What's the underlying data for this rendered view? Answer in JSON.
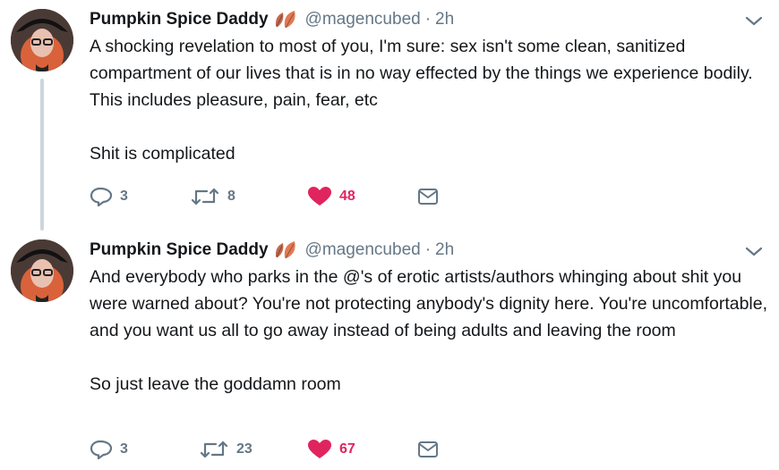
{
  "tweets": [
    {
      "name": "Pumpkin Spice Daddy",
      "emoji": "🍂",
      "handle": "@magencubed",
      "separator": "·",
      "time": "2h",
      "paragraphs": [
        "A shocking revelation to most of you, I'm sure: sex isn't some clean, sanitized compartment of our lives that is in no way effected by the things we experience bodily. This includes pleasure, pain, fear, etc",
        "Shit is complicated"
      ],
      "replies": "3",
      "retweets": "8",
      "likes": "48"
    },
    {
      "name": "Pumpkin Spice Daddy",
      "emoji": "🍂",
      "handle": "@magencubed",
      "separator": "·",
      "time": "2h",
      "paragraphs": [
        "And everybody who parks in the @'s of erotic artists/authors whinging about shit you were warned about? You're not protecting anybody's dignity here. You're uncomfortable, and you want us all to go away instead of being adults and leaving the room",
        "So just leave the goddamn room"
      ],
      "replies": "3",
      "retweets": "23",
      "likes": "67"
    }
  ],
  "colors": {
    "like": "#e0245e",
    "muted": "#657786",
    "text": "#14171a",
    "thread": "#ccd6dd"
  },
  "icons": [
    "reply-icon",
    "retweet-icon",
    "heart-icon",
    "dm-icon",
    "chevron-down-icon",
    "leaf-emoji-icon"
  ]
}
